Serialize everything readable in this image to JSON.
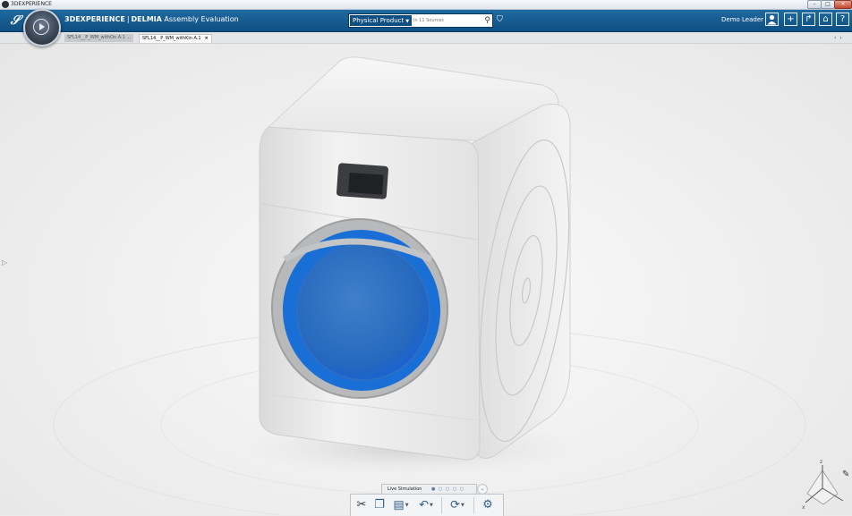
{
  "os_window": {
    "title": "3DEXPERIENCE",
    "minimize_glyph": "–",
    "maximize_glyph": "□",
    "close_glyph": "×"
  },
  "topbar": {
    "logo_glyph": "𝒮",
    "brand": "3DEXPERIENCE",
    "separator": "|",
    "product": "DELMIA",
    "app_name": "Assembly Evaluation",
    "search": {
      "filter_label": "Physical Product",
      "placeholder": "in 11 Sources"
    },
    "user_name": "Demo Leader",
    "icons": [
      "avatar-icon",
      "add-icon",
      "share-icon",
      "home-icon",
      "help-icon"
    ],
    "add_glyph": "+",
    "share_glyph": "↱",
    "home_glyph": "⌂",
    "help_glyph": "?"
  },
  "tabs": [
    {
      "label": "SFL14__P_WM_withOn A.1 ...",
      "active": false
    },
    {
      "label": "SFL14__P_WM_withKin A.1",
      "active": true
    }
  ],
  "tab_close_glyph": "×",
  "tab_nav_glyph": "‹ ›",
  "viewport": {
    "model": "washing-machine",
    "accent_color": "#1a6fd6",
    "background_color": "#f1f1f1"
  },
  "simulation_bar": {
    "label": "Live Simulation",
    "dots": "● ○ ○ ○ ○",
    "chevron_glyph": "⌄"
  },
  "action_bar": {
    "tools": [
      "cut-icon",
      "copy-icon",
      "paste-icon",
      "undo-icon",
      "simulation-icon",
      "robot-icon"
    ],
    "cut_glyph": "✂",
    "copy_glyph": "❐",
    "paste_glyph": "▤",
    "undo_glyph": "↶",
    "sim_glyph": "⟳",
    "robot_glyph": "⚙"
  },
  "triad": {
    "z_label": "z",
    "x_label": "x"
  }
}
